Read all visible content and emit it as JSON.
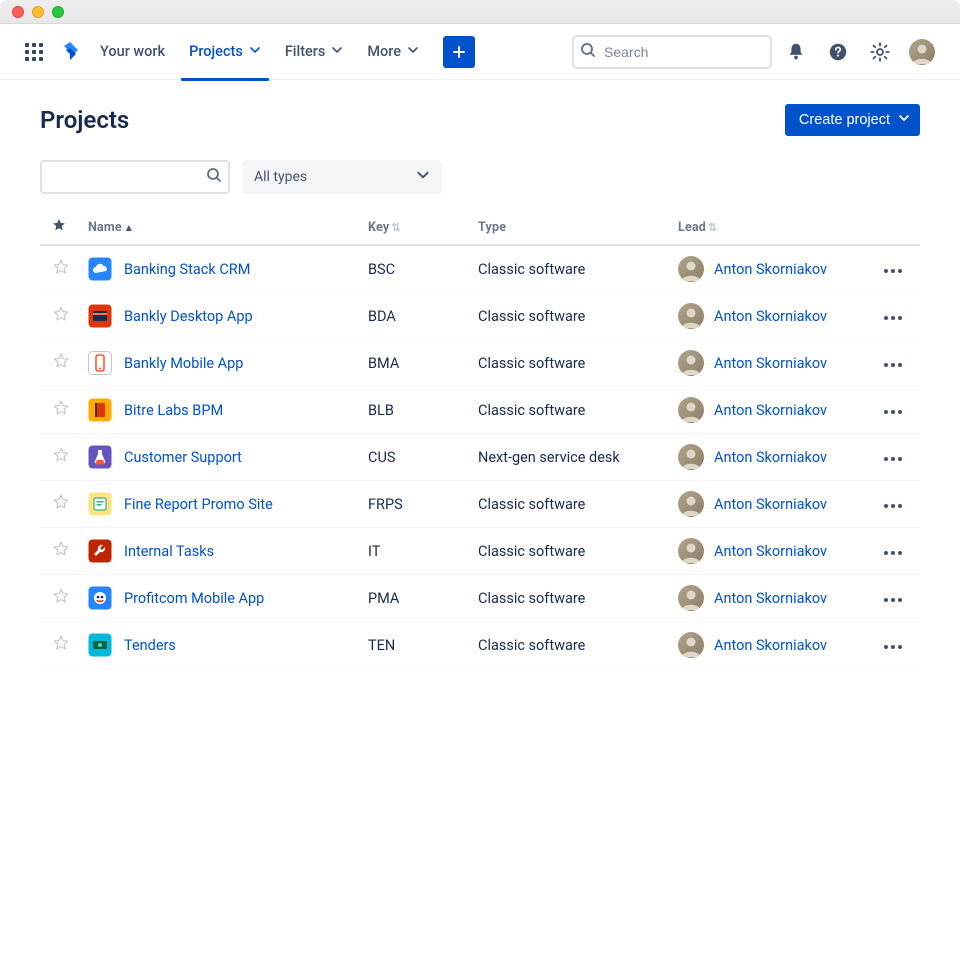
{
  "nav": {
    "your_work": "Your work",
    "projects": "Projects",
    "filters": "Filters",
    "more": "More",
    "search_placeholder": "Search"
  },
  "page": {
    "title": "Projects",
    "create_btn": "Create project",
    "type_filter": "All types"
  },
  "columns": {
    "name": "Name",
    "key": "Key",
    "type": "Type",
    "lead": "Lead"
  },
  "projects": [
    {
      "name": "Banking Stack CRM",
      "key": "BSC",
      "type": "Classic software",
      "lead": "Anton Skorniakov",
      "icon_bg": "#2684FF",
      "icon_kind": "cloud"
    },
    {
      "name": "Bankly Desktop App",
      "key": "BDA",
      "type": "Classic software",
      "lead": "Anton Skorniakov",
      "icon_bg": "#DE350B",
      "icon_kind": "card"
    },
    {
      "name": "Bankly Mobile App",
      "key": "BMA",
      "type": "Classic software",
      "lead": "Anton Skorniakov",
      "icon_bg": "#FFFFFF",
      "icon_kind": "phone"
    },
    {
      "name": "Bitre Labs BPM",
      "key": "BLB",
      "type": "Classic software",
      "lead": "Anton Skorniakov",
      "icon_bg": "#FFAB00",
      "icon_kind": "flag"
    },
    {
      "name": "Customer Support",
      "key": "CUS",
      "type": "Next-gen service desk",
      "lead": "Anton Skorniakov",
      "icon_bg": "#6554C0",
      "icon_kind": "flask"
    },
    {
      "name": "Fine Report Promo Site",
      "key": "FRPS",
      "type": "Classic software",
      "lead": "Anton Skorniakov",
      "icon_bg": "#FFE380",
      "icon_kind": "frame"
    },
    {
      "name": "Internal Tasks",
      "key": "IT",
      "type": "Classic software",
      "lead": "Anton Skorniakov",
      "icon_bg": "#BF2600",
      "icon_kind": "wrench"
    },
    {
      "name": "Profitcom Mobile App",
      "key": "PMA",
      "type": "Classic software",
      "lead": "Anton Skorniakov",
      "icon_bg": "#2684FF",
      "icon_kind": "robot"
    },
    {
      "name": "Tenders",
      "key": "TEN",
      "type": "Classic software",
      "lead": "Anton Skorniakov",
      "icon_bg": "#00B8D9",
      "icon_kind": "cash"
    }
  ]
}
